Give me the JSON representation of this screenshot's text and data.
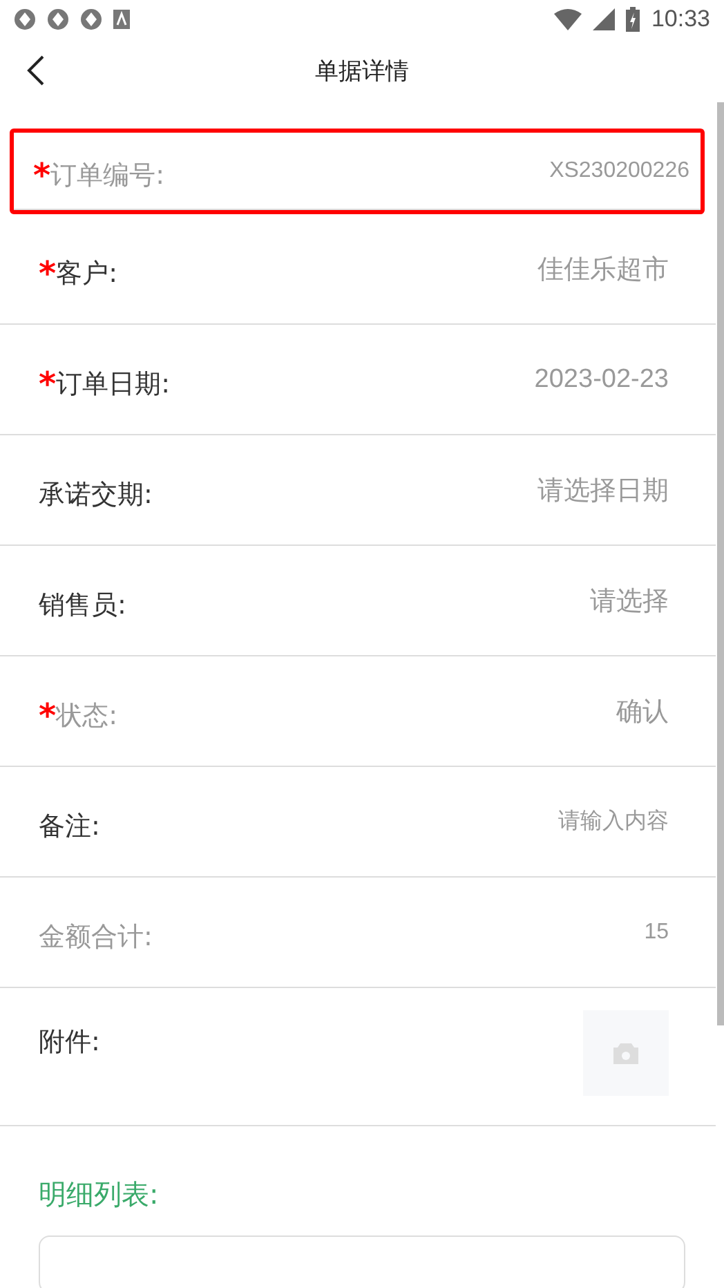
{
  "status_bar": {
    "time": "10:33"
  },
  "header": {
    "title": "单据详情"
  },
  "fields": [
    {
      "label": "订单编号:",
      "required": true,
      "disabled": true,
      "highlighted": true,
      "kind": "input",
      "value": "XS230200226"
    },
    {
      "label": "客户:",
      "required": true,
      "disabled": false,
      "highlighted": false,
      "kind": "picker",
      "value": "佳佳乐超市"
    },
    {
      "label": "订单日期:",
      "required": true,
      "disabled": false,
      "highlighted": false,
      "kind": "picker",
      "value": "2023-02-23"
    },
    {
      "label": "承诺交期:",
      "required": false,
      "disabled": false,
      "highlighted": false,
      "kind": "picker",
      "placeholder": "请选择日期"
    },
    {
      "label": "销售员:",
      "required": false,
      "disabled": false,
      "highlighted": false,
      "kind": "picker",
      "placeholder": "请选择"
    },
    {
      "label": "状态:",
      "required": true,
      "disabled": true,
      "highlighted": false,
      "kind": "picker",
      "value": "确认"
    },
    {
      "label": "备注:",
      "required": false,
      "disabled": false,
      "highlighted": false,
      "kind": "input",
      "placeholder": "请输入内容"
    },
    {
      "label": "金额合计:",
      "required": false,
      "disabled": true,
      "highlighted": false,
      "kind": "input",
      "value": "15"
    },
    {
      "label": "附件:",
      "required": false,
      "disabled": false,
      "highlighted": false,
      "kind": "attachment"
    }
  ],
  "detail": {
    "title": "明细列表:"
  },
  "required_mark": "*"
}
